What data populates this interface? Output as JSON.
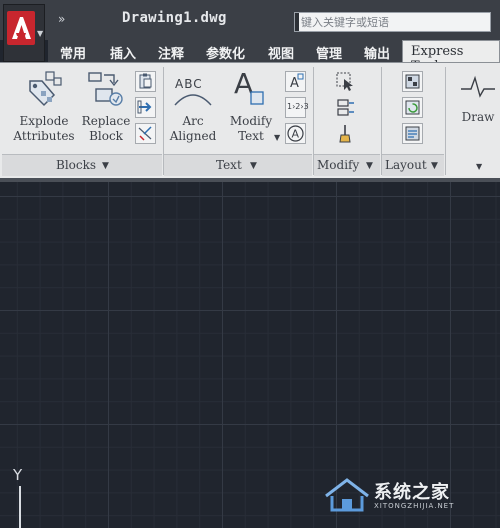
{
  "titlebar": {
    "document_title": "Drawing1.dwg",
    "search_placeholder": "键入关键字或短语",
    "quick_access_chevron": "»"
  },
  "tabs": [
    {
      "label": "常用"
    },
    {
      "label": "插入"
    },
    {
      "label": "注释"
    },
    {
      "label": "参数化"
    },
    {
      "label": "视图"
    },
    {
      "label": "管理"
    },
    {
      "label": "输出"
    },
    {
      "label": "Express Tools"
    }
  ],
  "panels": {
    "blocks": {
      "title": "Blocks",
      "explode_attributes": {
        "line1": "Explode",
        "line2": "Attributes"
      },
      "replace_block": {
        "line1": "Replace",
        "line2": "Block"
      }
    },
    "text": {
      "title": "Text",
      "arc_aligned": {
        "line1": "Arc",
        "line2": "Aligned"
      },
      "modify_text": {
        "line1": "Modify",
        "line2": "Text"
      },
      "abc": "ABC",
      "a_glyph": "A",
      "numbering": "1›2›3"
    },
    "modify": {
      "title": "Modify"
    },
    "layout": {
      "title": "Layout"
    },
    "draw": {
      "label": "Draw"
    }
  },
  "canvas": {
    "ucs_y_label": "Y"
  },
  "watermark": {
    "text": "系统之家",
    "sub": "XITONGZHIJIA.NET"
  },
  "colors": {
    "titlebar": "#3b3f46",
    "ribbon": "#e8e9ea",
    "canvas": "#20252e",
    "autocad_red": "#c8262e"
  }
}
